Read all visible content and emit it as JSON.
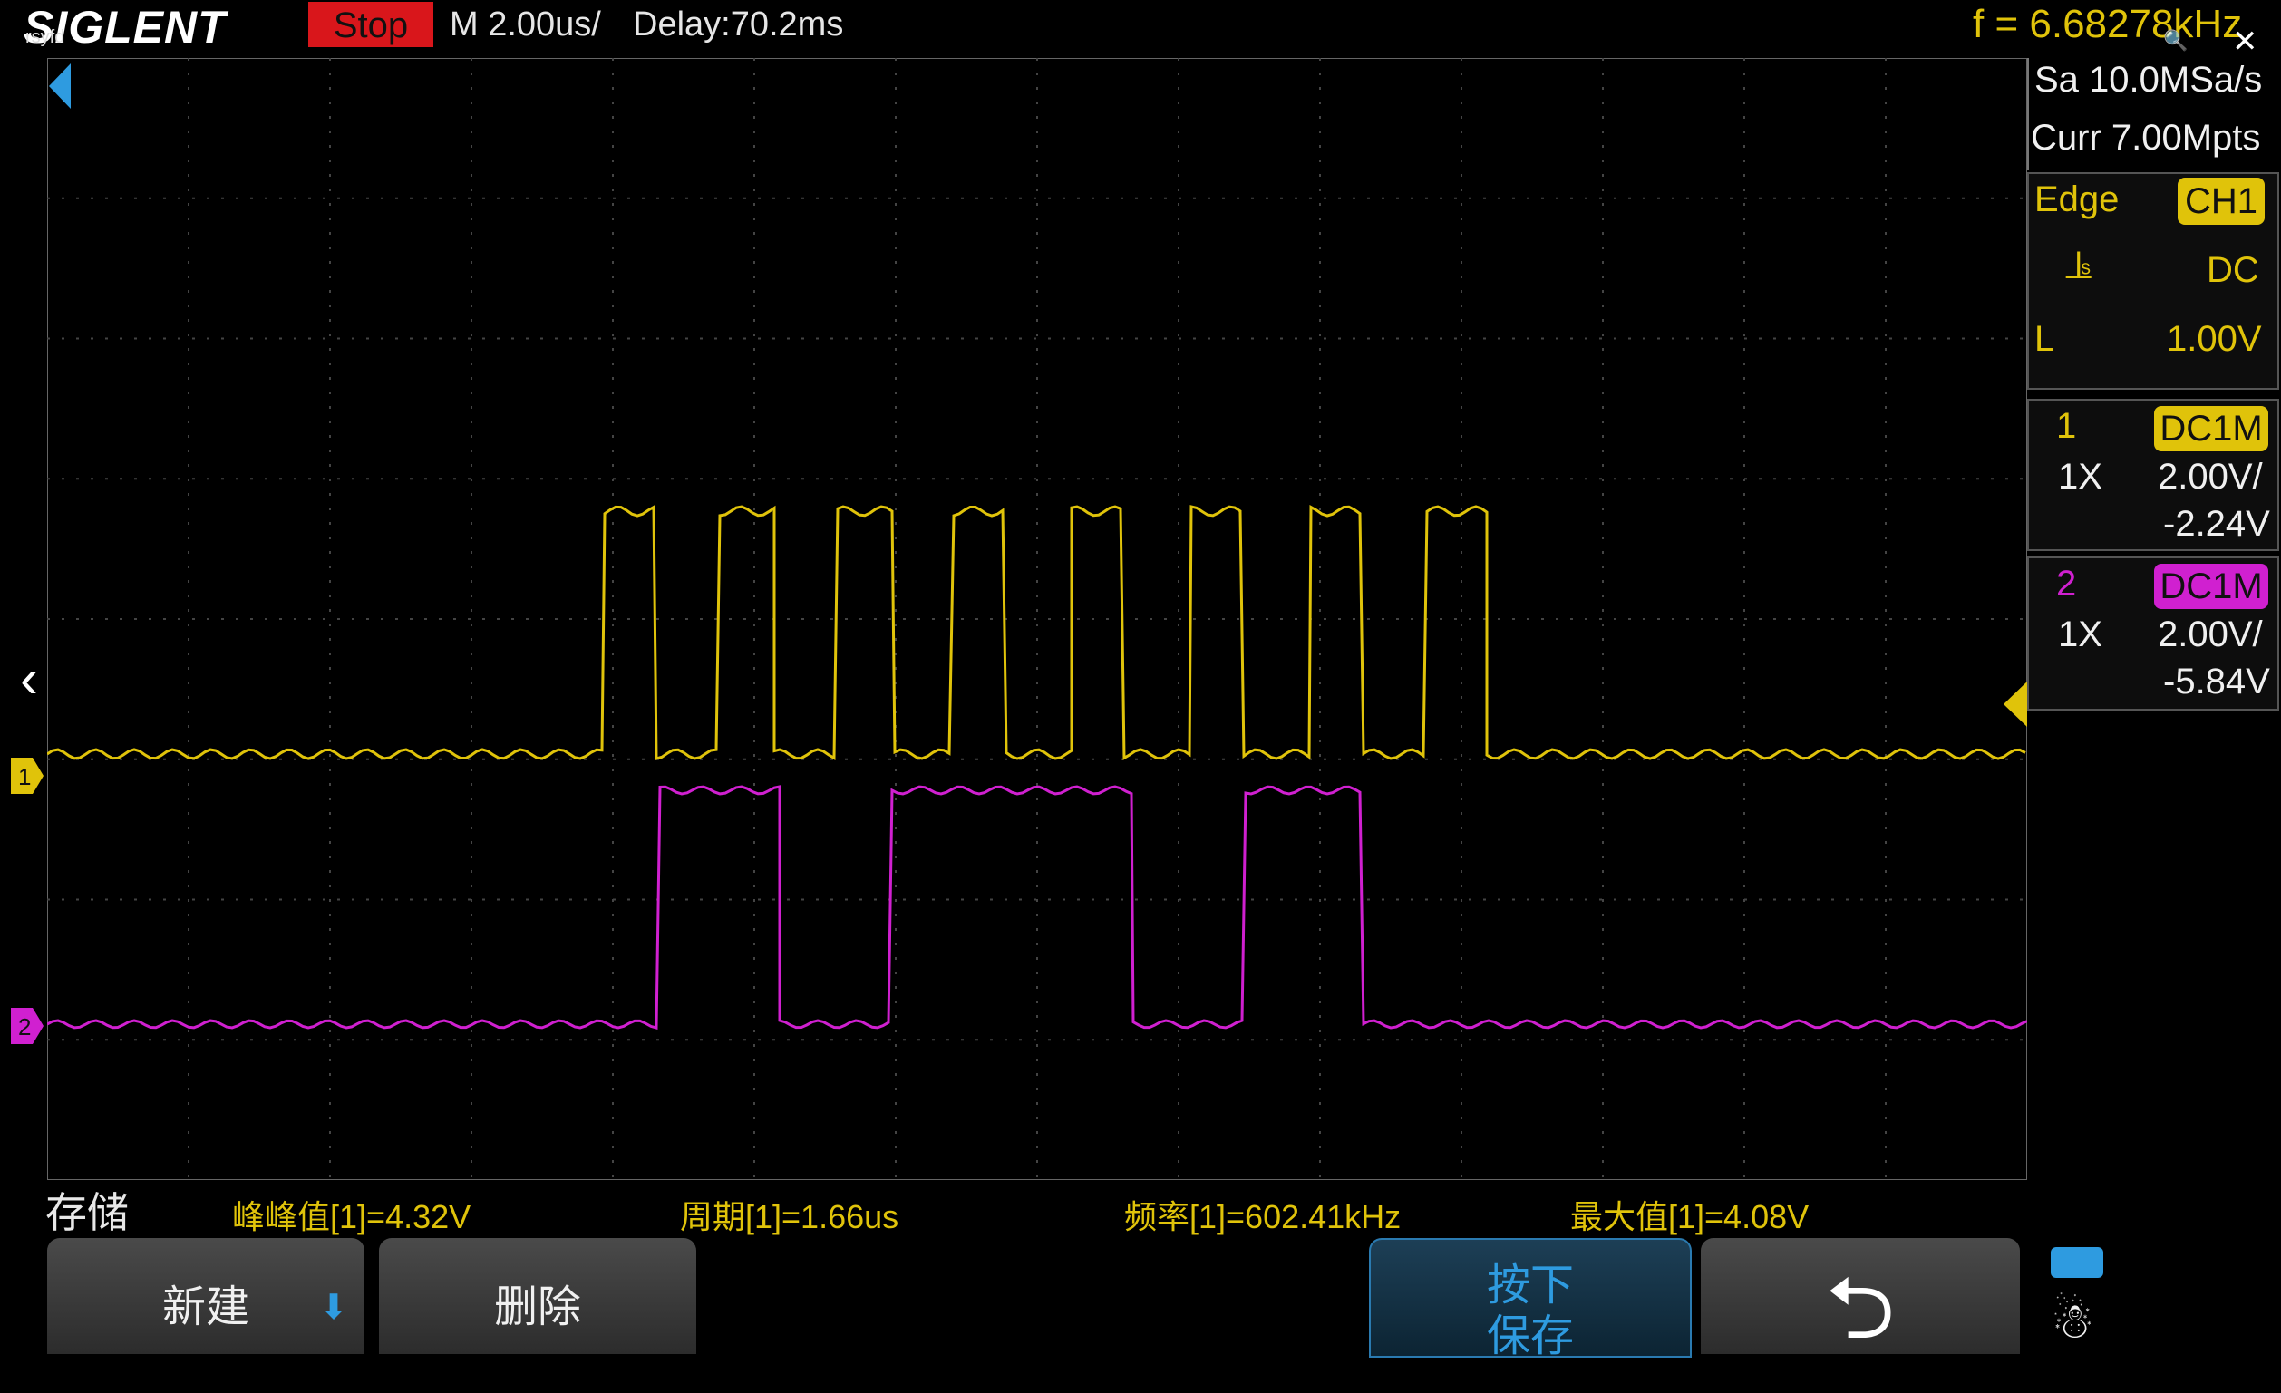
{
  "header": {
    "logo": "SIGLENT",
    "logo_sub": "rsyfd",
    "run_state": "Stop",
    "timebase": "M 2.00us/",
    "delay": "Delay:70.2ms",
    "frequency": "f = 6.68278kHz"
  },
  "acquisition": {
    "sample_rate": "Sa 10.0MSa/s",
    "memory_depth": "Curr 7.00Mpts"
  },
  "trigger": {
    "type": "Edge",
    "source": "CH1",
    "coupling": "DC",
    "level_label": "L",
    "level": "1.00V",
    "slope_icon": "rising-edge-icon"
  },
  "channels": [
    {
      "number": "1",
      "coupling": "DC1M",
      "probe": "1X",
      "scale": "2.00V/",
      "offset": "-2.24V",
      "color": "#e0c30a"
    },
    {
      "number": "2",
      "coupling": "DC1M",
      "probe": "1X",
      "scale": "2.00V/",
      "offset": "-5.84V",
      "color": "#d020d0"
    }
  ],
  "measurements": [
    "峰峰值[1]=4.32V",
    "周期[1]=1.66us",
    "频率[1]=602.41kHz",
    "最大值[1]=4.08V"
  ],
  "menu": {
    "title": "存储",
    "softkeys": {
      "new": "新建",
      "delete": "删除",
      "press_line1": "按下",
      "press_line2": "保存"
    }
  },
  "markers": {
    "ch1": "1",
    "ch2": "2"
  },
  "colors": {
    "ch1": "#e0c30a",
    "ch2": "#d020d0",
    "run_state_bg": "#d9161b",
    "accent": "#2e9be0"
  }
}
